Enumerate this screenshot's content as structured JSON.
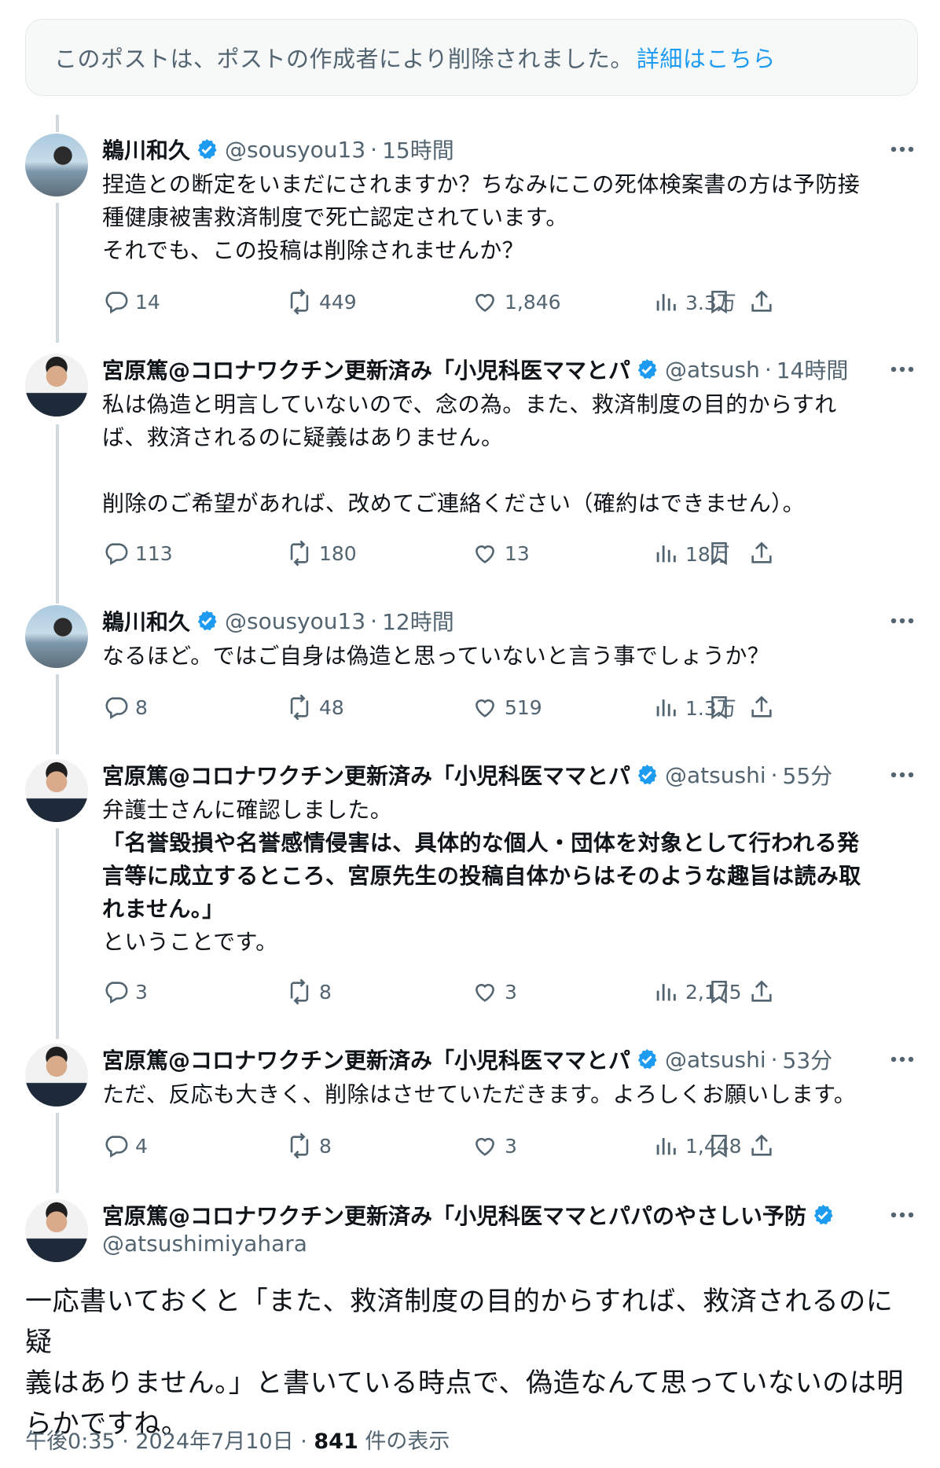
{
  "banner": {
    "text": "このポストは、ポストの作成者により削除されました。",
    "link": "詳細はこちら"
  },
  "tweets": [
    {
      "name": "鵜川和久",
      "handle": "@sousyou13",
      "time": "15時間",
      "lines": [
        "捏造との断定をいまだにされますか？ちなみにこの死体検案書の方は予防接",
        "種健康被害救済制度で死亡認定されています。",
        "それでも、この投稿は削除されませんか？"
      ],
      "replies": "14",
      "reposts": "449",
      "likes": "1,846",
      "views": "3.3万"
    },
    {
      "name": "宮原篤@コロナワクチン更新済み「小児科医ママとパ",
      "handle": "@atsush",
      "time": "14時間",
      "lines": [
        "私は偽造と明言していないので、念の為。また、救済制度の目的からすれ",
        "ば、救済されるのに疑義はありません。",
        "",
        "削除のご希望があれば、改めてご連絡ください（確約はできません）。"
      ],
      "replies": "113",
      "reposts": "180",
      "likes": "13",
      "views": "18万"
    },
    {
      "name": "鵜川和久",
      "handle": "@sousyou13",
      "time": "12時間",
      "lines": [
        "なるほど。ではご自身は偽造と思っていないと言う事でしょうか？"
      ],
      "replies": "8",
      "reposts": "48",
      "likes": "519",
      "views": "1.3万"
    },
    {
      "name": "宮原篤@コロナワクチン更新済み「小児科医ママとパ",
      "handle": "@atsushi",
      "time": "55分",
      "lines": [
        "弁護士さんに確認しました。"
      ],
      "bold_lines": [
        "「名誉毀損や名誉感情侵害は、具体的な個人・団体を対象として行われる発",
        "言等に成立するところ、宮原先生の投稿自体からはそのような趣旨は読み取",
        "れません。」"
      ],
      "tail_line": "ということです。",
      "replies": "3",
      "reposts": "8",
      "likes": "3",
      "views": "2,175"
    },
    {
      "name": "宮原篤@コロナワクチン更新済み「小児科医ママとパ",
      "handle": "@atsushi",
      "time": "53分",
      "lines": [
        "ただ、反応も大きく、削除はさせていただきます。よろしくお願いします。"
      ],
      "replies": "4",
      "reposts": "8",
      "likes": "3",
      "views": "1,448"
    }
  ],
  "main": {
    "name": "宮原篤@コロナワクチン更新済み「小児科医ママとパパのやさしい予防",
    "handle": "@atsushimiyahara",
    "lines": [
      "一応書いておくと「また、救済制度の目的からすれば、救済されるのに疑",
      "義はありません。」と書いている時点で、偽造なんて思っていないのは明",
      "らかですね。"
    ],
    "timestamp": "午後0:35 · 2024年7月10日 · ",
    "view_count": "841",
    "view_suffix": " 件の表示"
  },
  "colors": {
    "accent": "#1d9bf0",
    "muted": "#536471",
    "text": "#0f1419"
  },
  "icons": [
    "reply-icon",
    "repost-icon",
    "like-icon",
    "views-icon",
    "bookmark-icon",
    "share-icon",
    "more-icon",
    "verified-badge-icon"
  ]
}
